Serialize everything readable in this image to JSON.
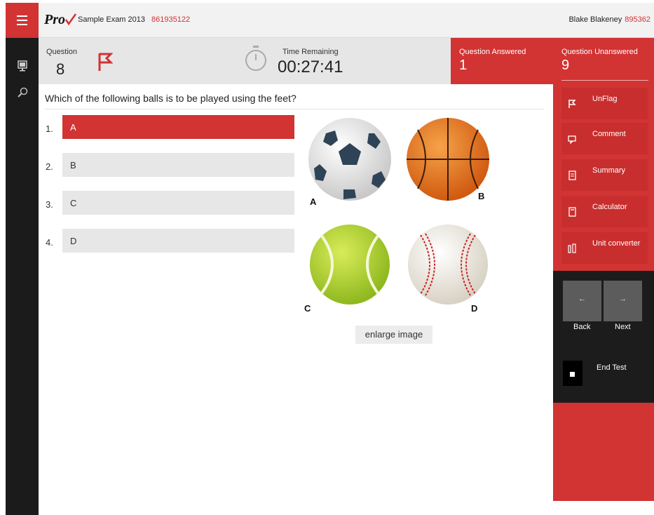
{
  "header": {
    "logo_text": "Pro",
    "exam_name": "Sample Exam 2013",
    "exam_id": "861935122",
    "user_name": "Blake Blakeney",
    "user_id": "895362"
  },
  "question_panel": {
    "question_label": "Question",
    "question_number": "8",
    "time_label": "Time Remaining",
    "time_value": "00:27:41"
  },
  "stats": {
    "answered_label": "Question Answered",
    "answered_count": "1",
    "unanswered_label": "Question Unanswered",
    "unanswered_count": "9"
  },
  "question": {
    "text": "Which of the following balls is to be played using the feet?",
    "options": [
      {
        "number": "1.",
        "label": "A",
        "selected": true
      },
      {
        "number": "2.",
        "label": "B",
        "selected": false
      },
      {
        "number": "3.",
        "label": "C",
        "selected": false
      },
      {
        "number": "4.",
        "label": "D",
        "selected": false
      }
    ],
    "image_letters": [
      "A",
      "B",
      "C",
      "D"
    ],
    "enlarge_label": "enlarge image"
  },
  "tools": [
    {
      "label": "UnFlag",
      "icon": "flag-icon"
    },
    {
      "label": "Comment",
      "icon": "comment-icon"
    },
    {
      "label": "Summary",
      "icon": "summary-icon"
    },
    {
      "label": "Calculator",
      "icon": "calculator-icon"
    },
    {
      "label": "Unit converter",
      "icon": "unit-converter-icon"
    }
  ],
  "navigation": {
    "back_label": "Back",
    "next_label": "Next",
    "back_arrow": "←",
    "next_arrow": "→",
    "end_test_label": "End Test"
  },
  "colors": {
    "accent": "#d23333",
    "dark": "#1c1c1c"
  }
}
